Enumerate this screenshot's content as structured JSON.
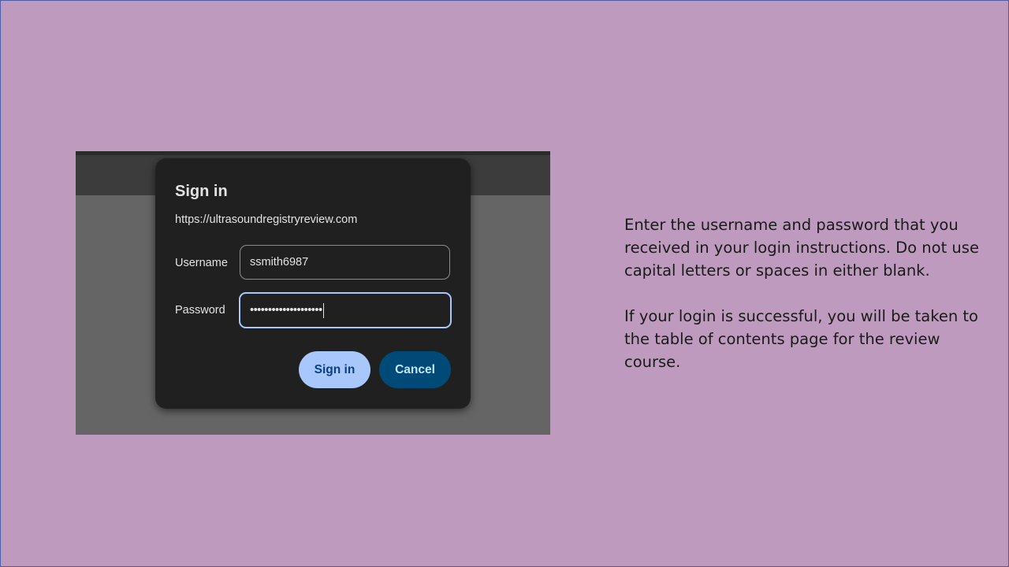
{
  "colors": {
    "slide_background": "#be9bbe",
    "slide_border": "#4b5fa8",
    "shot_topline": "#2b2b2b",
    "shot_topbar": "#3c3c3c",
    "shot_body": "#656565",
    "dialog_background": "#202020",
    "dialog_text": "#e3e3e3",
    "field_text": "#e3e3e3",
    "focus_ring": "#a8c7fa",
    "signin_button_bg": "#a8c7fa",
    "signin_button_text": "#0a3f86",
    "cancel_button_bg": "#004a77",
    "cancel_button_text": "#c2e7ff",
    "instruction_text": "#1a1a1a"
  },
  "dialog": {
    "title": "Sign in",
    "origin": "https://ultrasoundregistryreview.com",
    "username_label": "Username",
    "username_value": "ssmith6987",
    "password_label": "Password",
    "password_masked": "••••••••••••••••••••",
    "signin_label": "Sign in",
    "cancel_label": "Cancel"
  },
  "instructions": {
    "paragraph1_lines": [
      "Enter the username and password that you",
      "received in your login instructions. Do not use",
      "capital letters or spaces in either blank."
    ],
    "paragraph2_lines": [
      "If your login is successful, you will be taken to",
      "the table of contents page for the review",
      "course."
    ]
  }
}
